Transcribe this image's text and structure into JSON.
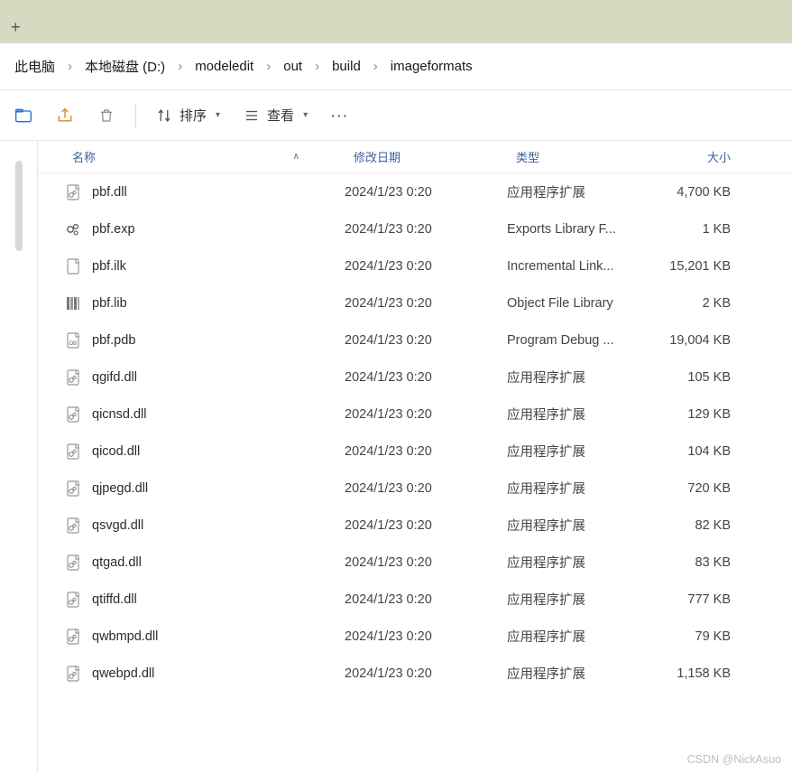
{
  "breadcrumbs": [
    "此电脑",
    "本地磁盘 (D:)",
    "modeledit",
    "out",
    "build",
    "imageformats"
  ],
  "toolbar": {
    "sort": "排序",
    "view": "查看"
  },
  "columns": {
    "name": "名称",
    "date": "修改日期",
    "type": "类型",
    "size": "大小"
  },
  "files": [
    {
      "icon": "dll",
      "name": "pbf.dll",
      "date": "2024/1/23 0:20",
      "type": "应用程序扩展",
      "size": "4,700 KB"
    },
    {
      "icon": "exp",
      "name": "pbf.exp",
      "date": "2024/1/23 0:20",
      "type": "Exports Library F...",
      "size": "1 KB"
    },
    {
      "icon": "ilk",
      "name": "pbf.ilk",
      "date": "2024/1/23 0:20",
      "type": "Incremental Link...",
      "size": "15,201 KB"
    },
    {
      "icon": "lib",
      "name": "pbf.lib",
      "date": "2024/1/23 0:20",
      "type": "Object File Library",
      "size": "2 KB"
    },
    {
      "icon": "pdb",
      "name": "pbf.pdb",
      "date": "2024/1/23 0:20",
      "type": "Program Debug ...",
      "size": "19,004 KB"
    },
    {
      "icon": "dll",
      "name": "qgifd.dll",
      "date": "2024/1/23 0:20",
      "type": "应用程序扩展",
      "size": "105 KB"
    },
    {
      "icon": "dll",
      "name": "qicnsd.dll",
      "date": "2024/1/23 0:20",
      "type": "应用程序扩展",
      "size": "129 KB"
    },
    {
      "icon": "dll",
      "name": "qicod.dll",
      "date": "2024/1/23 0:20",
      "type": "应用程序扩展",
      "size": "104 KB"
    },
    {
      "icon": "dll",
      "name": "qjpegd.dll",
      "date": "2024/1/23 0:20",
      "type": "应用程序扩展",
      "size": "720 KB"
    },
    {
      "icon": "dll",
      "name": "qsvgd.dll",
      "date": "2024/1/23 0:20",
      "type": "应用程序扩展",
      "size": "82 KB"
    },
    {
      "icon": "dll",
      "name": "qtgad.dll",
      "date": "2024/1/23 0:20",
      "type": "应用程序扩展",
      "size": "83 KB"
    },
    {
      "icon": "dll",
      "name": "qtiffd.dll",
      "date": "2024/1/23 0:20",
      "type": "应用程序扩展",
      "size": "777 KB"
    },
    {
      "icon": "dll",
      "name": "qwbmpd.dll",
      "date": "2024/1/23 0:20",
      "type": "应用程序扩展",
      "size": "79 KB"
    },
    {
      "icon": "dll",
      "name": "qwebpd.dll",
      "date": "2024/1/23 0:20",
      "type": "应用程序扩展",
      "size": "1,158 KB"
    }
  ],
  "watermark": "CSDN @NickAsuo"
}
